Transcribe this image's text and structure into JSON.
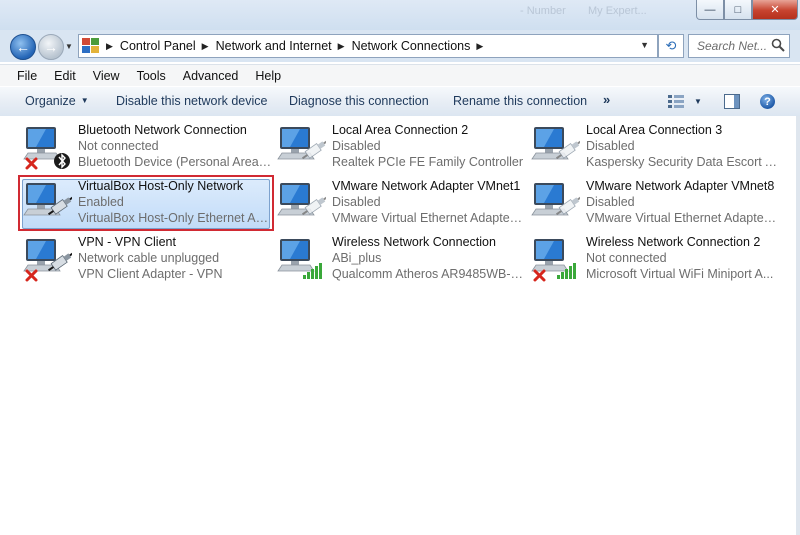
{
  "window": {
    "ghost_tabs": [
      "- Number",
      "My Expert..."
    ],
    "minimize": "—",
    "maximize": "□",
    "close": "✕"
  },
  "nav": {
    "back_glyph": "←",
    "forward_glyph": "→",
    "breadcrumbs": [
      "Control Panel",
      "Network and Internet",
      "Network Connections"
    ],
    "search_placeholder": "Search Net...",
    "refresh_glyph": "⟲"
  },
  "menu": [
    "File",
    "Edit",
    "View",
    "Tools",
    "Advanced",
    "Help"
  ],
  "commands": {
    "organize": "Organize",
    "disable": "Disable this network device",
    "diagnose": "Diagnose this connection",
    "rename": "Rename this connection",
    "more": "»",
    "help": "?"
  },
  "connections": [
    {
      "name": "Bluetooth Network Connection",
      "status": "Not connected",
      "device": "Bluetooth Device (Personal Area ...",
      "icon": "network-icon",
      "overlay": "bluetooth-icon",
      "x_mark": true,
      "selected": false
    },
    {
      "name": "Local Area Connection 2",
      "status": "Disabled",
      "device": "Realtek PCIe FE Family Controller",
      "icon": "network-icon",
      "overlay": "cable-disabled-icon",
      "x_mark": false,
      "selected": false
    },
    {
      "name": "Local Area Connection 3",
      "status": "Disabled",
      "device": "Kaspersky Security Data Escort Ad...",
      "icon": "network-icon",
      "overlay": "cable-disabled-icon",
      "x_mark": false,
      "selected": false
    },
    {
      "name": "VirtualBox Host-Only Network",
      "status": "Enabled",
      "device": "VirtualBox Host-Only Ethernet Ad...",
      "icon": "network-icon",
      "overlay": "cable-icon",
      "x_mark": false,
      "selected": true
    },
    {
      "name": "VMware Network Adapter VMnet1",
      "status": "Disabled",
      "device": "VMware Virtual Ethernet Adapter ...",
      "icon": "network-icon",
      "overlay": "cable-disabled-icon",
      "x_mark": false,
      "selected": false
    },
    {
      "name": "VMware Network Adapter VMnet8",
      "status": "Disabled",
      "device": "VMware Virtual Ethernet Adapter ...",
      "icon": "network-icon",
      "overlay": "cable-disabled-icon",
      "x_mark": false,
      "selected": false
    },
    {
      "name": "VPN - VPN Client",
      "status": "Network cable unplugged",
      "device": "VPN Client Adapter - VPN",
      "icon": "network-icon",
      "overlay": "cable-icon",
      "x_mark": true,
      "selected": false
    },
    {
      "name": "Wireless Network Connection",
      "status": "ABi_plus",
      "device": "Qualcomm Atheros AR9485WB-E...",
      "icon": "network-icon",
      "overlay": "wifi-signal-icon",
      "x_mark": false,
      "selected": false
    },
    {
      "name": "Wireless Network Connection 2",
      "status": "Not connected",
      "device": "Microsoft Virtual WiFi Miniport A...",
      "icon": "network-icon",
      "overlay": "wifi-signal-icon",
      "x_mark": true,
      "selected": false
    }
  ],
  "colors": {
    "selection_outline": "#d12a33",
    "selection_fill": "#c2dcf8",
    "command_text": "#1e395b",
    "secondary_text": "#6d6d6d"
  }
}
